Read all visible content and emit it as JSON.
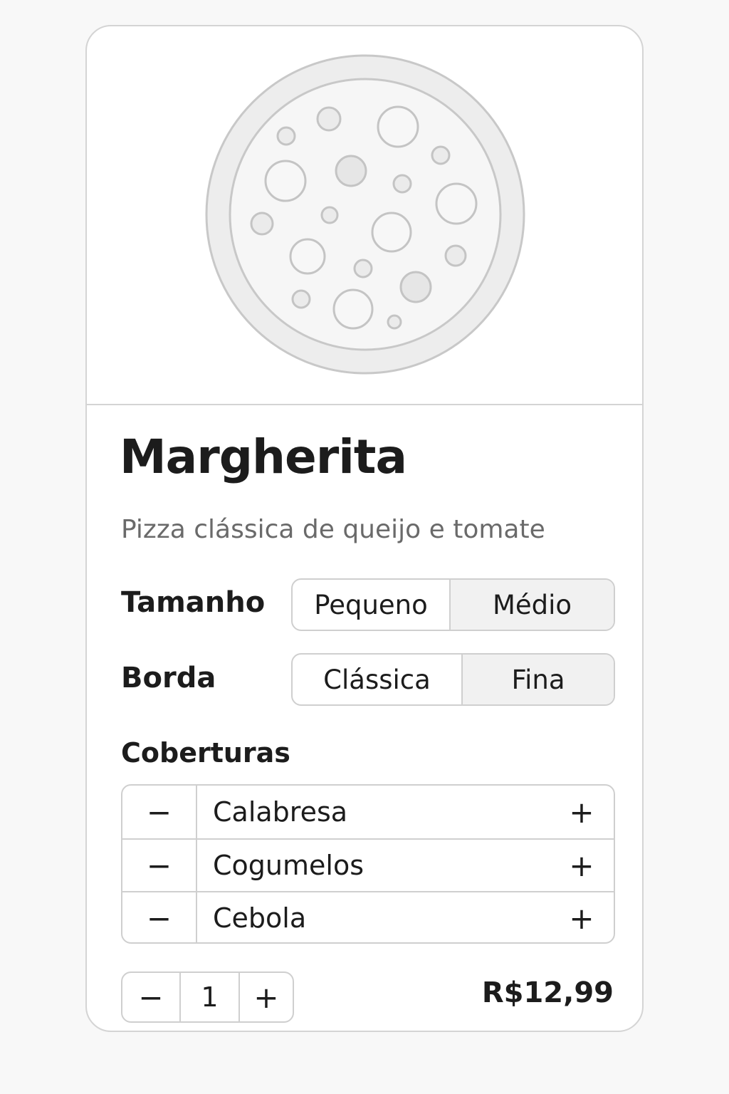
{
  "product": {
    "name": "Margherita",
    "description": "Pizza clássica de queijo e tomate",
    "image_icon": "pizza-illustration"
  },
  "options": {
    "size": {
      "label": "Tamanho",
      "choices": [
        "Pequeno",
        "Médio"
      ],
      "selected": "Médio"
    },
    "crust": {
      "label": "Borda",
      "choices": [
        "Clássica",
        "Fina"
      ],
      "selected": "Fina"
    }
  },
  "toppings": {
    "label": "Coberturas",
    "items": [
      {
        "name": "Calabresa",
        "minus": "−",
        "plus": "+"
      },
      {
        "name": "Cogumelos",
        "minus": "−",
        "plus": "+"
      },
      {
        "name": "Cebola",
        "minus": "−",
        "plus": "+"
      }
    ]
  },
  "quantity": {
    "minus": "−",
    "value": "1",
    "plus": "+"
  },
  "price": "R$12,99",
  "colors": {
    "border": "#cfcfcf",
    "selected_bg": "#f1f1f1",
    "text": "#1c1c1c",
    "muted_text": "#6a6a6a"
  }
}
